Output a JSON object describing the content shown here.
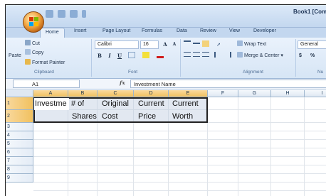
{
  "title": "Book1 [Com",
  "tabs": [
    "Home",
    "Insert",
    "Page Layout",
    "Formulas",
    "Data",
    "Review",
    "View",
    "Developer"
  ],
  "clipboard": {
    "cut": "Cut",
    "copy": "Copy",
    "paste": "Paste",
    "format_painter": "Format Painter",
    "label": "Clipboard"
  },
  "font": {
    "name": "Calibri",
    "size": "16",
    "label": "Font",
    "bold": "B",
    "italic": "I",
    "underline": "U",
    "grow": "A",
    "shrink": "A"
  },
  "alignment": {
    "wrap_text": "Wrap Text",
    "merge_center": "Merge & Center",
    "label": "Alignment"
  },
  "number": {
    "format": "General",
    "currency": "$",
    "percent": "%",
    "label": "Nu"
  },
  "name_box": "A1",
  "fx": "fx",
  "formula_value": "Investment Name",
  "columns": [
    "A",
    "B",
    "C",
    "D",
    "E",
    "F",
    "G",
    "H",
    "I"
  ],
  "rows": [
    "1",
    "2",
    "3",
    "4",
    "5",
    "6",
    "7",
    "8",
    "9"
  ],
  "cells": {
    "A1": "Investme",
    "B1": "# of",
    "C1": "Original",
    "D1": "Current",
    "E1": "Current",
    "B2": "Shares",
    "C2": "Cost",
    "D2": "Price",
    "E2": "Worth"
  },
  "colors": {
    "accent": "#c3d7ef",
    "selection_header": "#f1c15f",
    "office_button": "#f2a541"
  }
}
